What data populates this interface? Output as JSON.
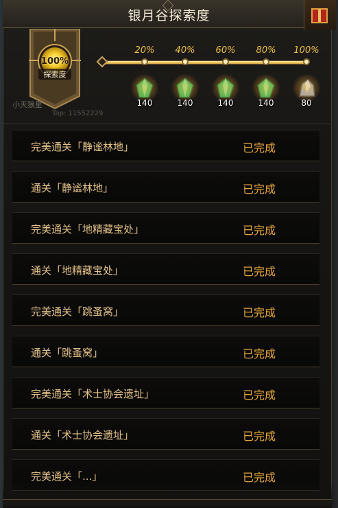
{
  "header": {
    "title": "银月谷探索度"
  },
  "banner": {
    "percent": "100%",
    "label": "探索度",
    "player_name": "小天狼星",
    "player_tap": "Tap: 11552229"
  },
  "progress": {
    "value_percent": 100,
    "milestones": [
      {
        "pct": "20%",
        "reward_count": "140",
        "reward_icon": "green-gem-icon"
      },
      {
        "pct": "40%",
        "reward_count": "140",
        "reward_icon": "green-gem-icon"
      },
      {
        "pct": "60%",
        "reward_count": "140",
        "reward_icon": "green-gem-icon"
      },
      {
        "pct": "80%",
        "reward_count": "140",
        "reward_icon": "green-gem-icon"
      },
      {
        "pct": "100%",
        "reward_count": "80",
        "reward_icon": "silver-ore-icon"
      }
    ]
  },
  "tasks": [
    {
      "label": "完美通关「静谧林地」",
      "status": "已完成"
    },
    {
      "label": "通关「静谧林地」",
      "status": "已完成"
    },
    {
      "label": "完美通关「地精藏宝处」",
      "status": "已完成"
    },
    {
      "label": "通关「地精藏宝处」",
      "status": "已完成"
    },
    {
      "label": "完美通关「跳蚤窝」",
      "status": "已完成"
    },
    {
      "label": "通关「跳蚤窝」",
      "status": "已完成"
    },
    {
      "label": "完美通关「术士协会遗址」",
      "status": "已完成"
    },
    {
      "label": "通关「术士协会遗址」",
      "status": "已完成"
    },
    {
      "label": "完美通关「...」",
      "status": "已完成"
    }
  ],
  "colors": {
    "accent_gold": "#f2c14a",
    "status_orange": "#e9a83c",
    "task_text": "#e4c288"
  }
}
